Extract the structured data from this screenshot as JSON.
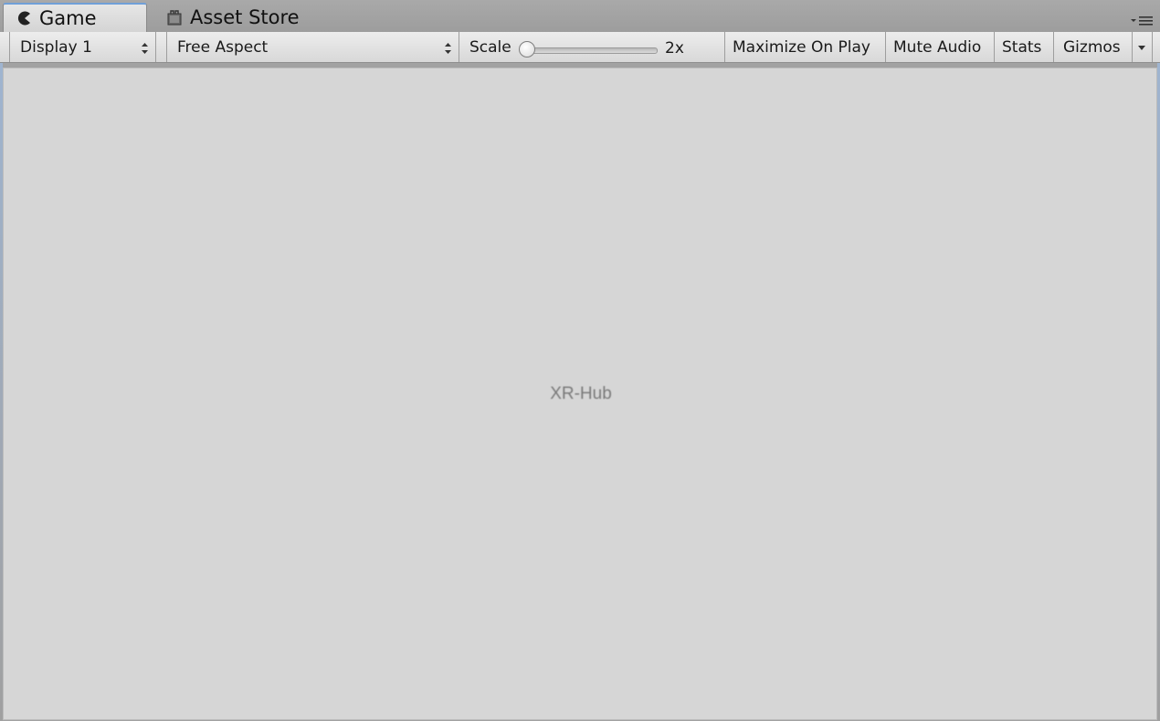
{
  "tabs": [
    {
      "label": "Game",
      "icon": "pacman-game-icon",
      "active": true
    },
    {
      "label": "Asset Store",
      "icon": "shopping-bag-icon",
      "active": false
    }
  ],
  "toolbar": {
    "display_select": "Display 1",
    "aspect_select": "Free Aspect",
    "scale_label": "Scale",
    "scale_value": "2x",
    "scale_fraction": 0.0,
    "maximize_on_play": "Maximize On Play",
    "mute_audio": "Mute Audio",
    "stats": "Stats",
    "gizmos": "Gizmos"
  },
  "viewport": {
    "text": "XR-Hub"
  },
  "colors": {
    "tab_accent": "#6f9fd8",
    "viewport_bg": "#d6d6d6",
    "toolbar_bg": "#e4e4e4"
  }
}
